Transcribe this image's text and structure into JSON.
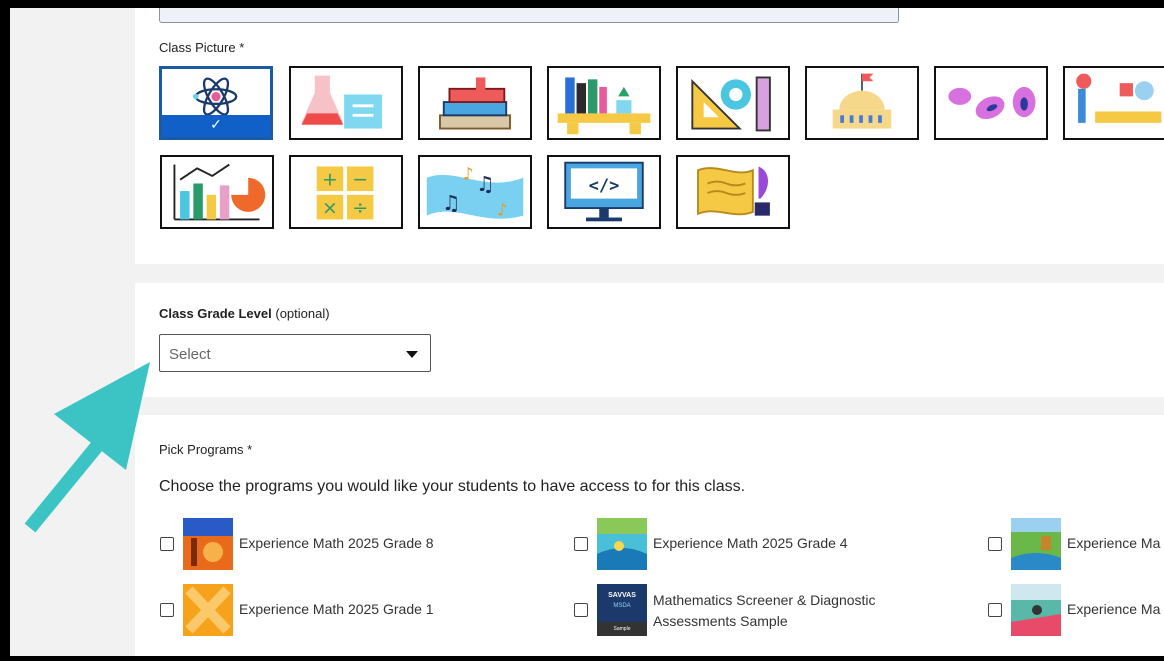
{
  "class_picture": {
    "label": "Class Picture *",
    "pictures": [
      {
        "name": "atom-picture",
        "selected": true
      },
      {
        "name": "chemistry-picture",
        "selected": false
      },
      {
        "name": "books-picture",
        "selected": false
      },
      {
        "name": "bookshelf-picture",
        "selected": false
      },
      {
        "name": "geometry-tools-picture",
        "selected": false
      },
      {
        "name": "capitol-building-picture",
        "selected": false
      },
      {
        "name": "bacteria-picture",
        "selected": false
      },
      {
        "name": "art-supplies-picture",
        "selected": false
      },
      {
        "name": "bar-chart-picture",
        "selected": false
      },
      {
        "name": "math-operators-picture",
        "selected": false
      },
      {
        "name": "music-notes-picture",
        "selected": false
      },
      {
        "name": "code-monitor-picture",
        "selected": false
      },
      {
        "name": "scroll-quill-picture",
        "selected": false
      }
    ],
    "selected_check": "✓"
  },
  "grade_level": {
    "label": "Class Grade Level",
    "optional": "(optional)",
    "select_value": "Select"
  },
  "programs": {
    "label": "Pick Programs *",
    "description": "Choose the programs you would like your students to have access to for this class.",
    "items": [
      {
        "label": "Experience Math 2025 Grade 8"
      },
      {
        "label": "Experience Math 2025 Grade 4"
      },
      {
        "label": "Experience Ma"
      },
      {
        "label": "Experience Math 2025 Grade 1"
      },
      {
        "label": "Mathematics Screener & Diagnostic Assessments Sample"
      },
      {
        "label": "Experience Ma"
      }
    ],
    "msda_thumb": {
      "brand": "SAVVAS",
      "line2": "MSDA",
      "line3": "Sample"
    }
  },
  "colors": {
    "arrow": "#3cc4c4",
    "selection": "#1060c8"
  }
}
